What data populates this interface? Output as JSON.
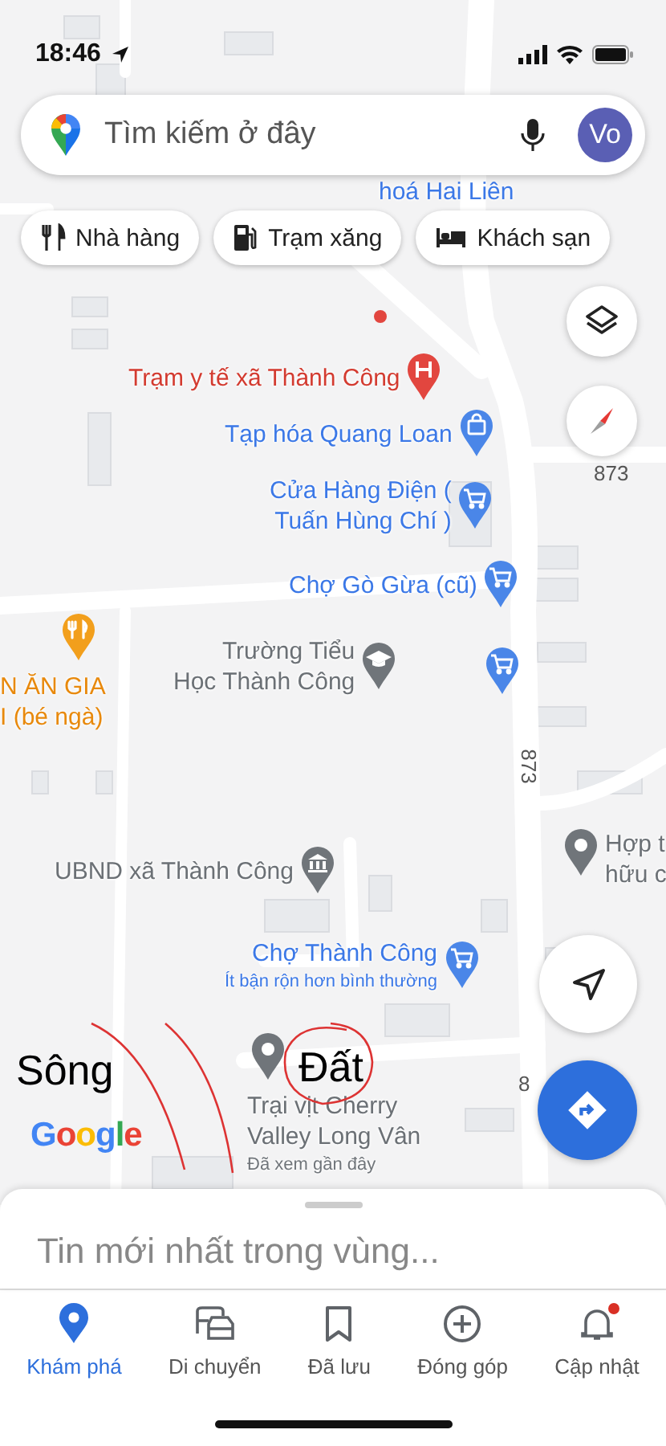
{
  "status_bar": {
    "time": "18:46"
  },
  "search": {
    "placeholder": "Tìm kiếm ở đây",
    "avatar": "Vo"
  },
  "chips": [
    {
      "label": "Nhà hàng",
      "kind": "restaurant"
    },
    {
      "label": "Trạm xăng",
      "kind": "gas"
    },
    {
      "label": "Khách sạn",
      "kind": "hotel"
    }
  ],
  "map": {
    "places": [
      {
        "kind": "label",
        "lines": [
          "hoá Hai Liên"
        ]
      },
      {
        "kind": "health",
        "lines": [
          "Trạm y tế xã Thành Công"
        ]
      },
      {
        "kind": "shop",
        "lines": [
          "Tạp hóa Quang Loan"
        ]
      },
      {
        "kind": "store",
        "lines": [
          "Cửa Hàng Điện (",
          "Tuấn Hùng Chí )"
        ]
      },
      {
        "kind": "store",
        "lines": [
          "Chợ Gò Gừa (cũ)"
        ]
      },
      {
        "kind": "store"
      },
      {
        "kind": "school",
        "lines": [
          "Trường Tiểu",
          "Học Thành Công"
        ]
      },
      {
        "kind": "restaurant",
        "lines": [
          "N ĂN GIA",
          "I (bé ngà)"
        ]
      },
      {
        "kind": "government",
        "lines": [
          "UBND xã Thành Công"
        ]
      },
      {
        "kind": "generic",
        "lines": [
          "Hợp t",
          "hữu c"
        ]
      },
      {
        "kind": "store",
        "lines": [
          "Chợ Thành Công"
        ],
        "note": "Ít bận rộn hơn bình thường"
      },
      {
        "kind": "generic",
        "lines": [
          "Trại vịt Cherry",
          "Valley Long Vân"
        ],
        "note": "Đã xem gần đây"
      }
    ],
    "road_labels": [
      "873",
      "873",
      "8"
    ],
    "annotations": [
      {
        "text": "Sông"
      },
      {
        "text": "Đất"
      }
    ],
    "logo": "Google"
  },
  "sheet": {
    "title": "Tin mới nhất trong vùng..."
  },
  "nav": [
    {
      "label": "Khám phá",
      "kind": "explore",
      "selected": true,
      "badge": false
    },
    {
      "label": "Di chuyển",
      "kind": "commute",
      "selected": false,
      "badge": false
    },
    {
      "label": "Đã lưu",
      "kind": "saved",
      "selected": false,
      "badge": false
    },
    {
      "label": "Đóng góp",
      "kind": "contribute",
      "selected": false,
      "badge": false
    },
    {
      "label": "Cập nhật",
      "kind": "updates",
      "selected": false,
      "badge": true
    }
  ]
}
